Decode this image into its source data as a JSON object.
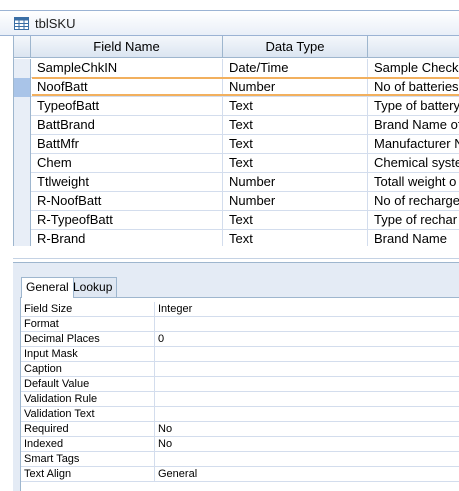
{
  "tab": {
    "title": "tblSKU",
    "icon": "table-icon"
  },
  "grid": {
    "headers": [
      "Field Name",
      "Data Type",
      ""
    ],
    "rows": [
      [
        "SampleChkIN",
        "Date/Time",
        "Sample Check"
      ],
      [
        "NoofBatt",
        "Number",
        "No of batteries"
      ],
      [
        "TypeofBatt",
        "Text",
        "Type of battery"
      ],
      [
        "BattBrand",
        "Text",
        "Brand Name of"
      ],
      [
        "BattMfr",
        "Text",
        "Manufacturer N"
      ],
      [
        "Chem",
        "Text",
        "Chemical system"
      ],
      [
        "Ttlweight",
        "Number",
        "Totall weight o"
      ],
      [
        "R-NoofBatt",
        "Number",
        "No of recharge"
      ],
      [
        "R-TypeofBatt",
        "Text",
        "Type of rechar"
      ],
      [
        "R-Brand",
        "Text",
        "Brand Name"
      ]
    ],
    "active_row": 1
  },
  "properties": {
    "tabs": [
      "General",
      "Lookup"
    ],
    "active_tab": "General",
    "rows": [
      [
        "Field Size",
        "Integer"
      ],
      [
        "Format",
        ""
      ],
      [
        "Decimal Places",
        "0"
      ],
      [
        "Input Mask",
        ""
      ],
      [
        "Caption",
        ""
      ],
      [
        "Default Value",
        ""
      ],
      [
        "Validation Rule",
        ""
      ],
      [
        "Validation Text",
        ""
      ],
      [
        "Required",
        "No"
      ],
      [
        "Indexed",
        "No"
      ],
      [
        "Smart Tags",
        ""
      ],
      [
        "Text Align",
        "General"
      ]
    ]
  },
  "colors": {
    "active_outline": "#f2b05e",
    "border": "#9eb6ce",
    "pane_bg": "#e4ebf5"
  }
}
